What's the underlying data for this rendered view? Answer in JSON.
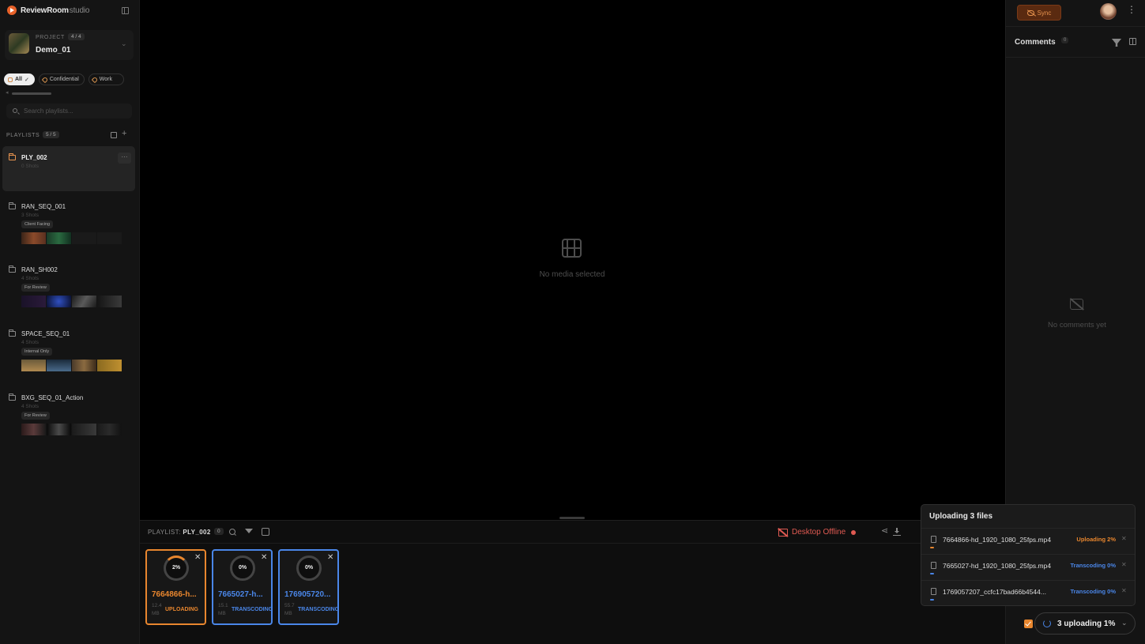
{
  "brand": {
    "name": "ReviewRoom",
    "suffix": "studio"
  },
  "project": {
    "label": "PROJECT",
    "count": "4 / 4",
    "name": "Demo_01"
  },
  "filters": [
    {
      "label": "All",
      "active": true
    },
    {
      "label": "Confidential",
      "active": false
    },
    {
      "label": "Work",
      "active": false
    }
  ],
  "search": {
    "placeholder": "Search playlists..."
  },
  "playlists_section": {
    "title": "PLAYLISTS",
    "count": "5 / 5"
  },
  "playlists": [
    {
      "name": "PLY_002",
      "sub": "0 Shots",
      "selected": true,
      "tag": ""
    },
    {
      "name": "RAN_SEQ_001",
      "sub": "3 Shots",
      "selected": false,
      "tag": "Client Facing"
    },
    {
      "name": "RAN_SH002",
      "sub": "4 Shots",
      "selected": false,
      "tag": "For Review"
    },
    {
      "name": "SPACE_SEQ_01",
      "sub": "4 Shots",
      "selected": false,
      "tag": "Internal Only"
    },
    {
      "name": "BXG_SEQ_01_Action",
      "sub": "4 Shots",
      "selected": false,
      "tag": "For Review"
    }
  ],
  "viewer": {
    "empty_text": "No media selected"
  },
  "bottom_panel": {
    "label_prefix": "PLAYLIST:",
    "label_name": "PLY_002",
    "count": "0",
    "offline_text": "Desktop Offline"
  },
  "upload_cards": [
    {
      "name": "7664866-h...",
      "pct": "2%",
      "size": "12.4 MB",
      "status": "UPLOADING",
      "kind": "uploading"
    },
    {
      "name": "7665027-h...",
      "pct": "0%",
      "size": "15.1 MB",
      "status": "TRANSCODING",
      "kind": "transcoding"
    },
    {
      "name": "176905720...",
      "pct": "0%",
      "size": "55.7 MB",
      "status": "TRANSCODING",
      "kind": "transcoding"
    }
  ],
  "right_panel": {
    "sync_label": "Sync",
    "comments_title": "Comments",
    "comments_count": "0",
    "empty_text": "No comments yet"
  },
  "upload_popover": {
    "title": "Uploading 3 files",
    "files": [
      {
        "name": "7664866-hd_1920_1080_25fps.mp4",
        "status": "Uploading 2%",
        "color": "orange",
        "progress": 0.02
      },
      {
        "name": "7665027-hd_1920_1080_25fps.mp4",
        "status": "Transcoding 0%",
        "color": "blue",
        "progress": 0.0
      },
      {
        "name": "1769057207_ccfc17bad66b4544...",
        "status": "Transcoding 0%",
        "color": "blue",
        "progress": 0.0
      }
    ]
  },
  "upload_pill": {
    "text": "3 uploading 1%"
  },
  "colors": {
    "accent": "#e8862e",
    "transcode": "#4a86e8",
    "offline": "#e05a52"
  }
}
